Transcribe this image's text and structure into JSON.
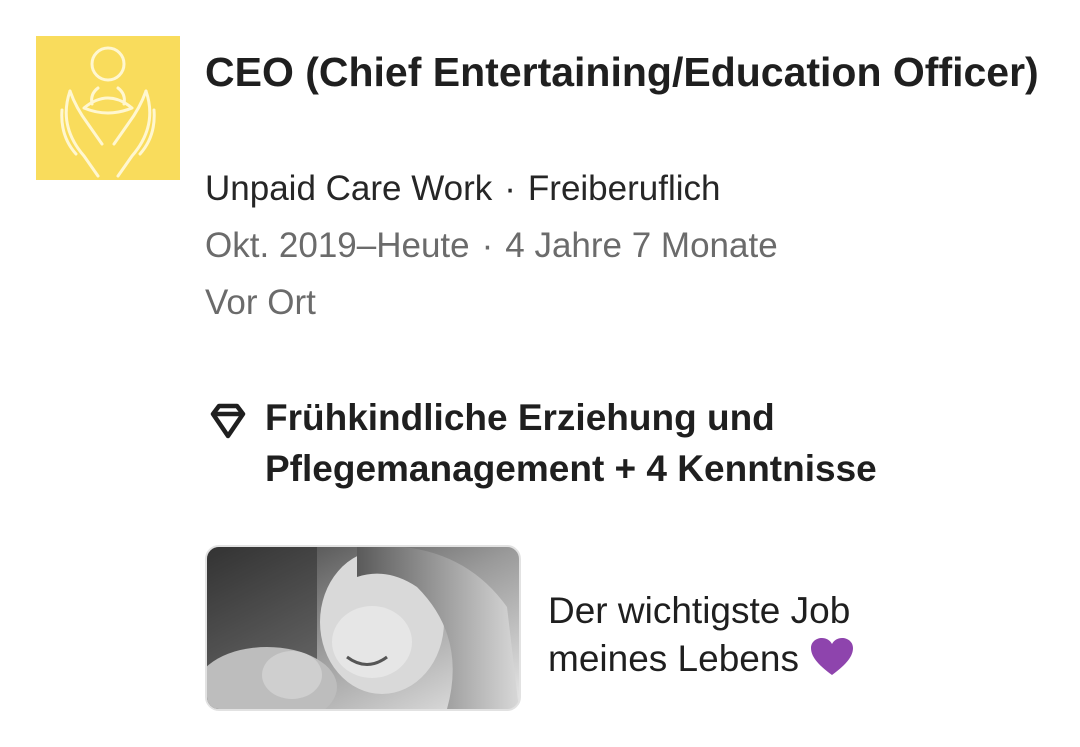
{
  "experience": {
    "title": "CEO (Chief Entertaining/Education Officer)",
    "company": "Unpaid Care Work",
    "employment_type": "Freiberuflich",
    "date_range": "Okt. 2019–Heute",
    "duration": "4 Jahre 7 Monate",
    "location": "Vor Ort",
    "separator": "·",
    "logo_icon": "hands-holding-person-icon",
    "logo_color": "#f9dc5c"
  },
  "skills": {
    "icon": "diamond-icon",
    "text": "Frühkindliche Erziehung und Pflegemanagement + 4 Kenntnisse"
  },
  "media": {
    "caption": "Der wichtigste Job meines Lebens",
    "caption_icon": "purple-heart-icon",
    "heart_color": "#8e44ad"
  }
}
